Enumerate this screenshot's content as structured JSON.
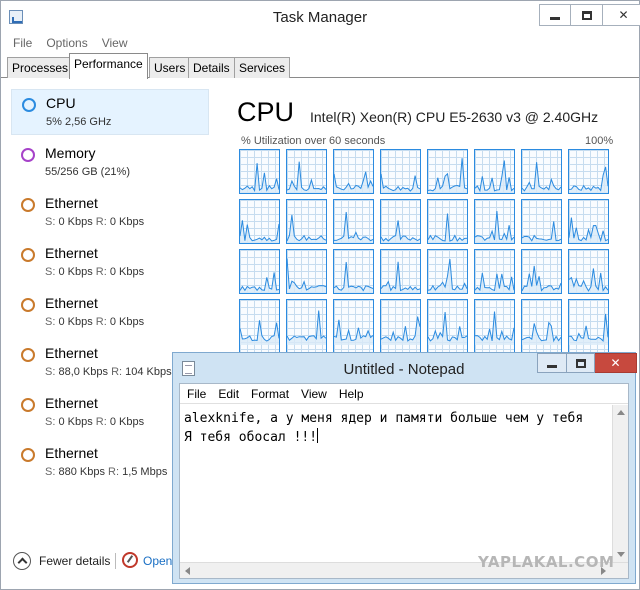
{
  "task_manager": {
    "title": "Task Manager",
    "menu": [
      "File",
      "Options",
      "View"
    ],
    "tabs": [
      "Processes",
      "Performance",
      "Users",
      "Details",
      "Services"
    ],
    "active_tab": "Performance",
    "sidebar": [
      {
        "name": "CPU",
        "sub": "5%  2,56 GHz",
        "color": "#2b8be0"
      },
      {
        "name": "Memory",
        "sub": "55/256 GB (21%)",
        "color": "#a642c9"
      },
      {
        "name": "Ethernet",
        "s": "0 Kbps",
        "r": "0 Kbps",
        "color": "#c97a2c"
      },
      {
        "name": "Ethernet",
        "s": "0 Kbps",
        "r": "0 Kbps",
        "color": "#c97a2c"
      },
      {
        "name": "Ethernet",
        "s": "0 Kbps",
        "r": "0 Kbps",
        "color": "#c97a2c"
      },
      {
        "name": "Ethernet",
        "s": "88,0 Kbps",
        "r": "104 Kbps",
        "color": "#c97a2c"
      },
      {
        "name": "Ethernet",
        "s": "0 Kbps",
        "r": "0 Kbps",
        "color": "#c97a2c"
      },
      {
        "name": "Ethernet",
        "s": "880 Kbps",
        "r": "1,5 Mbps",
        "color": "#c97a2c"
      }
    ],
    "s_prefix": "S:",
    "r_prefix": "R:",
    "cpu_heading": "CPU",
    "cpu_model": "Intel(R) Xeon(R) CPU E5-2630 v3 @ 2.40GHz",
    "util_label": "% Utilization over 60 seconds",
    "util_max": "100%",
    "graph_accent": "#2b8be0",
    "footer": {
      "fewer_details": "Fewer details",
      "open_link": "Open"
    }
  },
  "notepad": {
    "title": "Untitled - Notepad",
    "menu": [
      "File",
      "Edit",
      "Format",
      "View",
      "Help"
    ],
    "lines": [
      "alexknife, а у меня ядер и памяти больше чем у тебя",
      "Я тебя обосал !!!"
    ]
  },
  "watermark": "YAPLAKAL.COM"
}
